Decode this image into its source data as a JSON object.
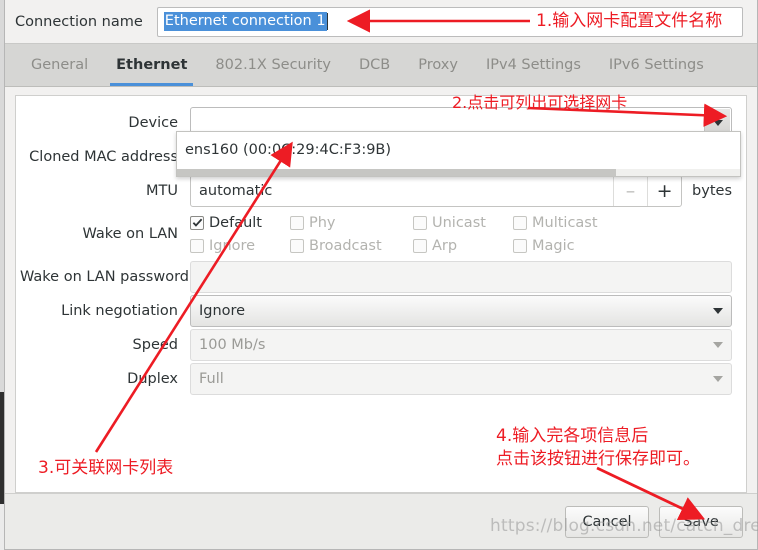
{
  "window": {
    "connection_name_label": "Connection name",
    "connection_name_value": "Ethernet connection 1"
  },
  "tabs": [
    {
      "label": "General",
      "active": false
    },
    {
      "label": "Ethernet",
      "active": true
    },
    {
      "label": "802.1X Security",
      "active": false
    },
    {
      "label": "DCB",
      "active": false
    },
    {
      "label": "Proxy",
      "active": false
    },
    {
      "label": "IPv4 Settings",
      "active": false
    },
    {
      "label": "IPv6 Settings",
      "active": false
    }
  ],
  "form": {
    "device": {
      "label": "Device",
      "value": ""
    },
    "cloned_mac": {
      "label": "Cloned MAC address",
      "value": ""
    },
    "mtu": {
      "label": "MTU",
      "value": "automatic",
      "minus": "–",
      "plus": "+",
      "units": "bytes"
    },
    "wake_on_lan": {
      "label": "Wake on LAN",
      "options": [
        {
          "label": "Default",
          "checked": true,
          "enabled": true
        },
        {
          "label": "Phy",
          "checked": false,
          "enabled": false
        },
        {
          "label": "Unicast",
          "checked": false,
          "enabled": false
        },
        {
          "label": "Multicast",
          "checked": false,
          "enabled": false
        },
        {
          "label": "Ignore",
          "checked": false,
          "enabled": false
        },
        {
          "label": "Broadcast",
          "checked": false,
          "enabled": false
        },
        {
          "label": "Arp",
          "checked": false,
          "enabled": false
        },
        {
          "label": "Magic",
          "checked": false,
          "enabled": false
        }
      ]
    },
    "wol_password": {
      "label": "Wake on LAN password",
      "value": ""
    },
    "link_negotiation": {
      "label": "Link negotiation",
      "value": "Ignore"
    },
    "speed": {
      "label": "Speed",
      "value": "100 Mb/s"
    },
    "duplex": {
      "label": "Duplex",
      "value": "Full"
    }
  },
  "device_dropdown": {
    "open": true,
    "items": [
      "ens160 (00:0C:29:4C:F3:9B)"
    ]
  },
  "buttons": {
    "cancel": "Cancel",
    "save": "Save"
  },
  "annotations": {
    "a1": "1.输入网卡配置文件名称",
    "a2": "2.点击可列出可选择网卡",
    "a3": "3.可关联网卡列表",
    "a4_line1": "4.输入完各项信息后",
    "a4_line2": "点击该按钮进行保存即可。",
    "color": "#ed1c24"
  },
  "watermark": "https://blog.csdn.net/catch_dreamer"
}
